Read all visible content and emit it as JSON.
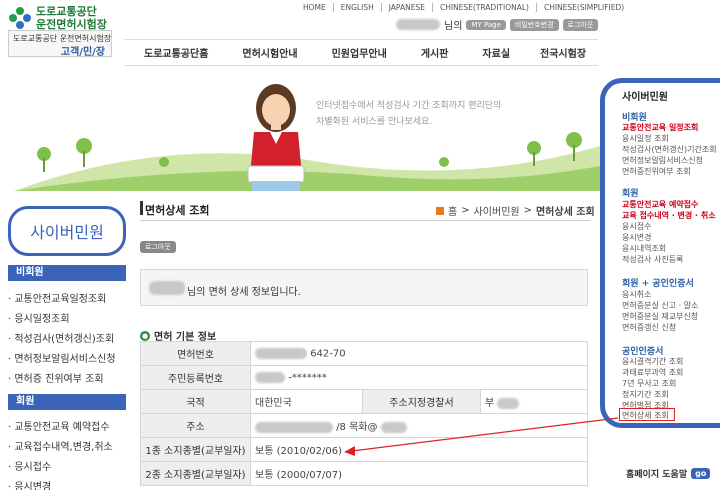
{
  "logo": {
    "line1": "도로교통공단",
    "line2": "운전면허시험장",
    "sub_line1": "도로교통공단  운전면허시험장",
    "sub_line2": "고객/민/장"
  },
  "top_links": [
    "HOME",
    "ENGLISH",
    "JAPANESE",
    "CHINESE(TRADITIONAL)",
    "CHINESE(SIMPLIFIED)"
  ],
  "user": {
    "suffix": "님의",
    "buttons": [
      "MY Page",
      "비밀번호변경",
      "로그아웃"
    ]
  },
  "nav": [
    "도로교통공단홈",
    "면허시험안내",
    "민원업무안내",
    "게시판",
    "자료실",
    "전국시험장"
  ],
  "banner": {
    "line1": "인터넷접수에서 적성검사 기간 조회까지 편리단의",
    "line2": "차별화된 서비스를 만나보세요."
  },
  "left": {
    "title": "사이버민원",
    "sections": [
      {
        "label": "비회원",
        "items": [
          "교통안전교육일정조회",
          "응시일정조회",
          "적성검사(면허갱신)조회",
          "면허정보알림서비스신청",
          "면허증 진위여부 조회"
        ]
      },
      {
        "label": "회원",
        "items": [
          "교통안전교육 예약접수",
          "교육접수내역,변경,취소",
          "응시접수",
          "응시변경"
        ]
      }
    ]
  },
  "page": {
    "title": "면허상세 조회",
    "breadcrumb": [
      "홈",
      "사이버민원",
      "면허상세 조회"
    ],
    "logout_label": "로그아웃",
    "info_message": "님의 면허 상세 정보입니다.",
    "section_title": "면허 기본 정보",
    "rows": [
      {
        "label": "면허번호",
        "value": "642-70"
      },
      {
        "label": "주민등록번호",
        "value": "-*******"
      },
      {
        "label": "국적",
        "value": "대한민국",
        "label2": "주소지정경찰서",
        "value2": "부"
      },
      {
        "label": "주소",
        "value": "/8 목화@"
      },
      {
        "label": "1종 소지종별(교부일자)",
        "value": "보통 (2010/02/06)"
      },
      {
        "label": "2종 소지종별(교부일자)",
        "value": "보통 (2000/07/07)"
      }
    ]
  },
  "right": {
    "title": "사이버민원",
    "groups": [
      {
        "label": "비회원",
        "items": [
          {
            "text": "교통안전교육 일정조회",
            "red": true
          },
          {
            "text": "응시일정 조회",
            "red": false
          },
          {
            "text": "적성검사(면허갱신)기간조회",
            "red": false
          },
          {
            "text": "면허정보알림서비스신청",
            "red": false
          },
          {
            "text": "면허증진위여부 조회",
            "red": false
          }
        ]
      },
      {
        "label": "회원",
        "items": [
          {
            "text": "교통안전교육 예약접수",
            "red": true
          },
          {
            "text": "교육 접수내역 · 변경 · 취소",
            "red": true
          },
          {
            "text": "응시접수",
            "red": false
          },
          {
            "text": "응시변경",
            "red": false
          },
          {
            "text": "응시내역조회",
            "red": false
          },
          {
            "text": "적성검사 사진등록",
            "red": false
          }
        ]
      },
      {
        "label": "회원 + 공인인증서",
        "items": [
          {
            "text": "응시취소",
            "red": false
          },
          {
            "text": "면허증분실 신고 · 말소",
            "red": false
          },
          {
            "text": "면허증분실 재교부신청",
            "red": false
          },
          {
            "text": "면허증갱신 신청",
            "red": false
          }
        ]
      },
      {
        "label": "공인인증서",
        "items": [
          {
            "text": "응시결격기간 조회",
            "red": false
          },
          {
            "text": "과태료부과역 조회",
            "red": false
          },
          {
            "text": "7년 무사고 조회",
            "red": false
          },
          {
            "text": "정지기간 조회",
            "red": false
          },
          {
            "text": "면허벌점 조회",
            "red": false
          },
          {
            "text": "면허상세 조회",
            "red": false
          }
        ]
      }
    ],
    "help_label": "홈페이지 도움말",
    "go_label": "go"
  },
  "colors": {
    "brand_blue": "#3b63b8",
    "brand_green": "#1f7a3a",
    "highlight_red": "#e02020"
  }
}
